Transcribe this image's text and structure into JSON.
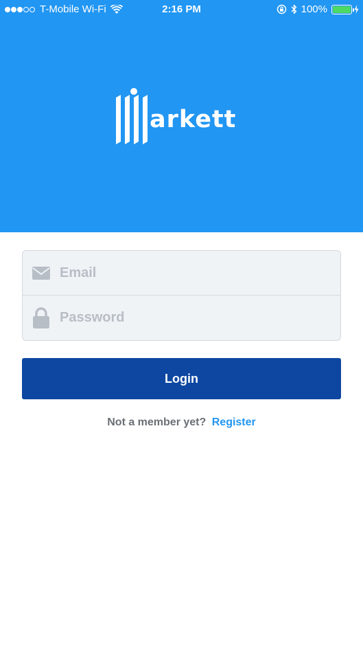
{
  "status_bar": {
    "carrier": "T-Mobile Wi-Fi",
    "time": "2:16 PM",
    "battery_percent": "100%",
    "signal_bars_filled": 3,
    "signal_bars_total": 5,
    "battery_level": 1.0
  },
  "hero": {
    "brand": "Markett",
    "logo_text": "arkett",
    "background_color": "#2196f3"
  },
  "form": {
    "email": {
      "placeholder": "Email",
      "value": "",
      "icon": "envelope-icon"
    },
    "password": {
      "placeholder": "Password",
      "value": "",
      "icon": "lock-icon"
    }
  },
  "login_button": {
    "label": "Login",
    "color": "#0d47a1"
  },
  "register": {
    "prompt": "Not a member yet?",
    "link": "Register",
    "link_color": "#2196f3"
  }
}
